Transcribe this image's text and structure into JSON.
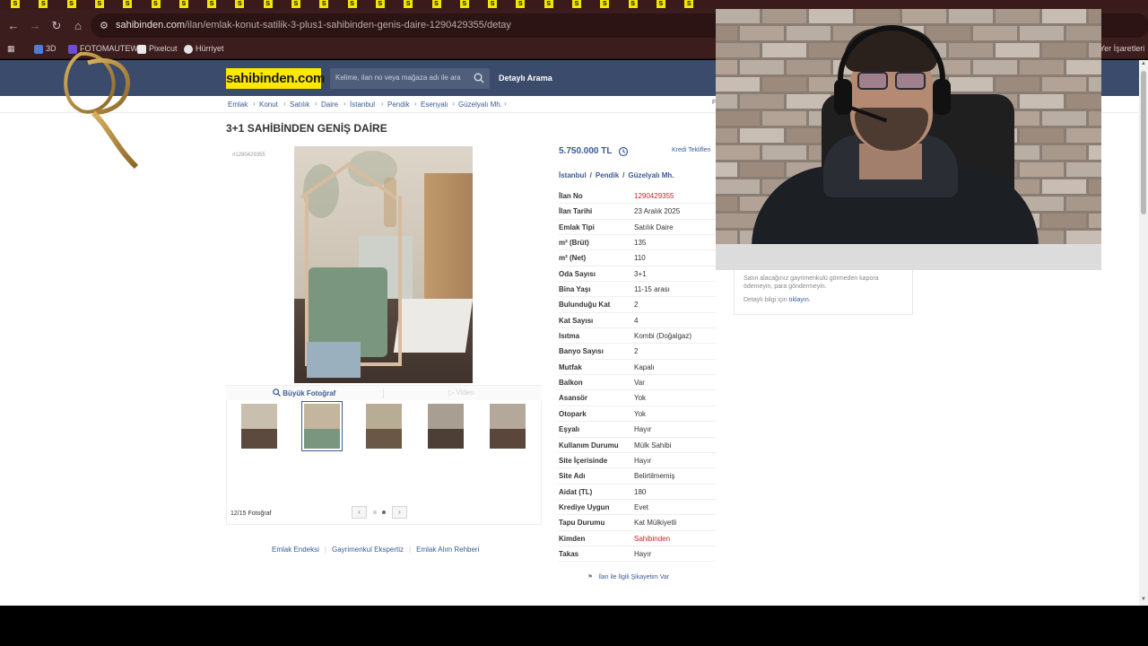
{
  "browser": {
    "url_host": "sahibinden.com",
    "url_path": "/ilan/emlak-konut-satilik-3-plus1-sahibinden-genis-daire-1290429355/detay",
    "bookmarks": [
      "3D",
      "FOTOMAUTEW",
      "Pixelcut",
      "Hürriyet"
    ],
    "bookmarks_right": "Yer İşaretleri"
  },
  "site": {
    "logo": "sahibinden.com",
    "search_placeholder": "Kelime, ilan no veya mağaza adı ile ara",
    "detailed_search": "Detaylı Arama"
  },
  "breadcrumb": [
    "Emlak",
    "Konut",
    "Satılık",
    "Daire",
    "İstanbul",
    "Pendik",
    "Esenyalı",
    "Güzelyalı Mh."
  ],
  "listing": {
    "title": "3+1 SAHİBİNDEN GENİŞ DAİRE",
    "id_label": "#1290429355",
    "big_photo_label": "Büyük Fotoğraf",
    "video_label": "Video",
    "photo_count": "12/15 Fotoğraf",
    "price": "5.750.000 TL",
    "credit_offers": "Kredi Teklifleri",
    "location": [
      "İstanbul",
      "Pendik",
      "Güzelyalı Mh."
    ],
    "details": [
      {
        "key": "İlan No",
        "value": "1290429355",
        "highlight": true
      },
      {
        "key": "İlan Tarihi",
        "value": "23 Aralık 2025"
      },
      {
        "key": "Emlak Tipi",
        "value": "Satılık Daire"
      },
      {
        "key": "m² (Brüt)",
        "value": "135"
      },
      {
        "key": "m² (Net)",
        "value": "110"
      },
      {
        "key": "Oda Sayısı",
        "value": "3+1"
      },
      {
        "key": "Bina Yaşı",
        "value": "11-15 arası"
      },
      {
        "key": "Bulunduğu Kat",
        "value": "2"
      },
      {
        "key": "Kat Sayısı",
        "value": "4"
      },
      {
        "key": "Isıtma",
        "value": "Kombi (Doğalgaz)"
      },
      {
        "key": "Banyo Sayısı",
        "value": "2"
      },
      {
        "key": "Mutfak",
        "value": "Kapalı"
      },
      {
        "key": "Balkon",
        "value": "Var"
      },
      {
        "key": "Asansör",
        "value": "Yok"
      },
      {
        "key": "Otopark",
        "value": "Yok"
      },
      {
        "key": "Eşyalı",
        "value": "Hayır"
      },
      {
        "key": "Kullanım Durumu",
        "value": "Mülk Sahibi"
      },
      {
        "key": "Site İçerisinde",
        "value": "Hayır"
      },
      {
        "key": "Site Adı",
        "value": "Belirtilmemiş"
      },
      {
        "key": "Aidat (TL)",
        "value": "180"
      },
      {
        "key": "Krediye Uygun",
        "value": "Evet"
      },
      {
        "key": "Tapu Durumu",
        "value": "Kat Mülkiyetli"
      },
      {
        "key": "Kimden",
        "value": "Sahibinden",
        "highlight": true
      },
      {
        "key": "Takas",
        "value": "Hayır"
      }
    ],
    "complaint": "İlan ile İlgili Şikayetim Var"
  },
  "footer_links": [
    "Emlak Endeksi",
    "Gayrimenkul Ekspertiz",
    "Emlak Alım Rehberi"
  ],
  "safety": {
    "line1": "Satın alacağınız gayrimenkulü görmeden kapora",
    "line2": "ödemeyin, para göndermeyin.",
    "line3_prefix": "Detaylı bilgi için",
    "line3_link": "tıklayın."
  },
  "colors": {
    "header_bg": "#3b4b6b",
    "logo_bg": "#ffe800",
    "link": "#3a5b95",
    "highlight": "#c8202b",
    "chrome_bg": "#3a1d1c"
  }
}
